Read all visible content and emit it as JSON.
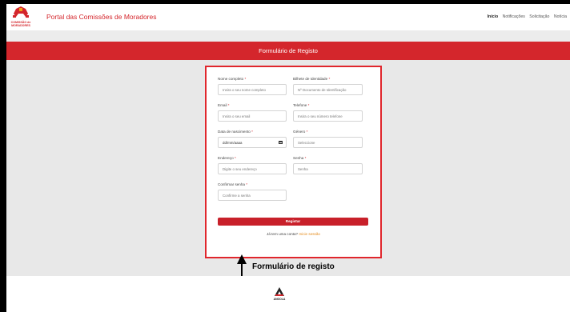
{
  "header": {
    "logo_caption": "COMISSÃO de MORADORES",
    "title": "Portal das Comissões de Moradores",
    "nav": [
      {
        "label": "Início",
        "active": true
      },
      {
        "label": "Notificações"
      },
      {
        "label": "Solicitação"
      },
      {
        "label": "Notícia"
      }
    ]
  },
  "banner": {
    "title": "Formulário de Registo"
  },
  "form": {
    "nome_label": "Nome completo",
    "nome_placeholder": "Insira o seu nome completo",
    "bi_label": "Bilhete de Identidade",
    "bi_placeholder": "Nº Documento de Identificação",
    "email_label": "Email",
    "email_placeholder": "Insira o seu email",
    "telefone_label": "Telefone",
    "telefone_placeholder": "Insira o seu número telefone",
    "nascimento_label": "Data de nascimento",
    "nascimento_value": "dd/mm/aaaa",
    "genero_label": "Género",
    "genero_value": "Seleccione",
    "endereco_label": "Endereço",
    "endereco_placeholder": "Digite o seu endereço",
    "senha_label": "Senha",
    "senha_placeholder": "Senha",
    "confirmar_label": "Confirmar senha",
    "confirmar_placeholder": "Confirme a senha",
    "required_mark": "*",
    "submit_label": "Registar",
    "login_prompt": "Já tem uma conta?",
    "login_link": "Inicie sessão"
  },
  "annotation": {
    "label": "Formulário de registo"
  },
  "footer": {
    "logo_caption": "ANGOLA"
  },
  "colors": {
    "brand_red": "#d4262c",
    "link_orange": "#e48a1a",
    "content_bg": "#e8e8e8"
  }
}
